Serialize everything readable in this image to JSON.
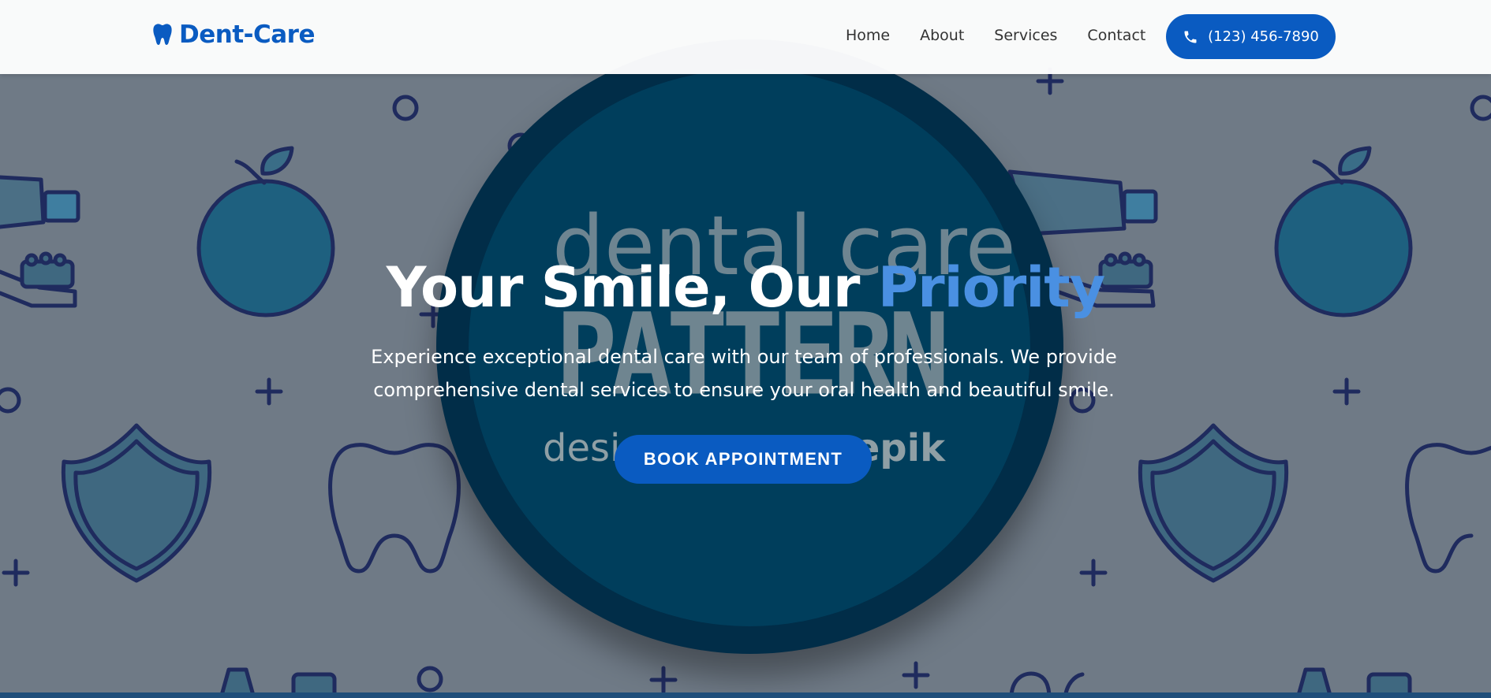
{
  "navbar": {
    "brand_icon": "tooth-icon",
    "brand_name": "Dent-Care",
    "links": [
      {
        "label": "Home"
      },
      {
        "label": "About"
      },
      {
        "label": "Services"
      },
      {
        "label": "Contact"
      }
    ],
    "phone": {
      "icon": "phone-icon",
      "label": "(123) 456-7890"
    }
  },
  "hero": {
    "headline_part1": "Your Smile, Our ",
    "headline_accent": "Priority",
    "subtitle": "Experience exceptional dental care with our team of professionals. We provide comprehensive dental services to ensure your oral health and beautiful smile.",
    "cta_label": "BOOK APPOINTMENT",
    "watermark": {
      "line1": "dental care",
      "line2": "PATTERN",
      "line3_left": "desi",
      "line3_right": "epik"
    }
  },
  "colors": {
    "brand_blue": "#0a5bc1",
    "accent_blue": "#4a90e2",
    "background_overlay": "#6f7a86",
    "circle_dark": "#003e5c"
  }
}
